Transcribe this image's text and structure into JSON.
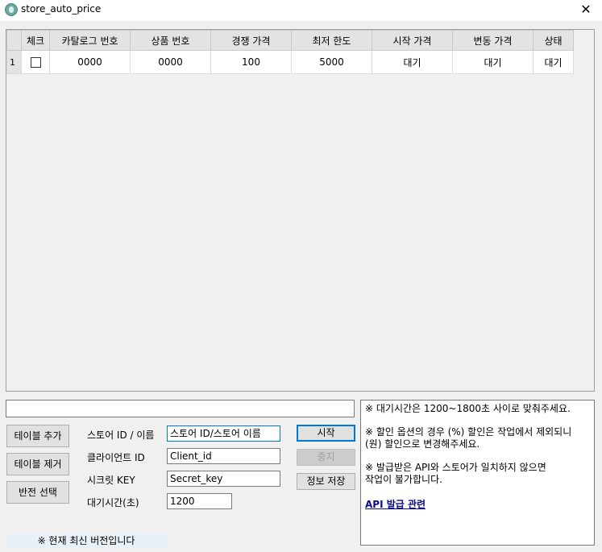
{
  "window": {
    "title": "store_auto_price",
    "close_glyph": "✕"
  },
  "table": {
    "headers": [
      "체크",
      "카탈로그 번호",
      "상품 번호",
      "경쟁 가격",
      "최저 한도",
      "시작 가격",
      "변동 가격",
      "상태"
    ],
    "rows": [
      {
        "row_num": "1",
        "checked": false,
        "catalog": "0000",
        "product": "0000",
        "competitor": "100",
        "min_limit": "5000",
        "start_price": "대기",
        "change_price": "대기",
        "status": "대기"
      }
    ]
  },
  "buttons": {
    "add_table": "테이블 추가",
    "remove_table": "테이블 제거",
    "invert_select": "반전 선택",
    "start": "시작",
    "stop": "중지",
    "save_info": "정보 저장"
  },
  "form": {
    "store_label": "스토어 ID / 이름",
    "store_value": "스토어 ID/스토어 이름",
    "client_label": "클라이언트 ID",
    "client_value": "Client_id",
    "secret_label": "시크릿 KEY",
    "secret_value": "Secret_key",
    "wait_label": "대기시간(초)",
    "wait_value": "1200"
  },
  "info": {
    "line1": "※ 대기시간은 1200~1800초 사이로 맞춰주세요.",
    "line2a": "※ 할인 옵션의 경우 (%) 할인은 작업에서 제외되니",
    "line2b": "(원) 할인으로 변경해주세요.",
    "line3a": "※ 발급받은 API와 스토어가 일치하지 않으면",
    "line3b": "작업이 불가합니다.",
    "link": "API 발급 관련"
  },
  "version_text": "※ 현재 최신 버전입니다"
}
